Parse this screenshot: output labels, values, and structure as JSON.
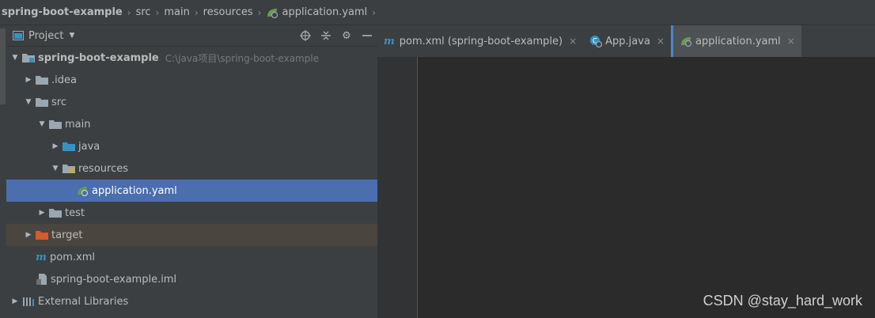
{
  "breadcrumb": [
    "spring-boot-example",
    "src",
    "main",
    "resources",
    "application.yaml"
  ],
  "project_panel": {
    "title": "Project"
  },
  "tree": [
    {
      "label": "spring-boot-example",
      "path": "C:\\java项目\\spring-boot-example",
      "depth": 0,
      "expanded": true,
      "kind": "module"
    },
    {
      "label": ".idea",
      "depth": 1,
      "expanded": false,
      "kind": "folder"
    },
    {
      "label": "src",
      "depth": 1,
      "expanded": true,
      "kind": "folder"
    },
    {
      "label": "main",
      "depth": 2,
      "expanded": true,
      "kind": "folder"
    },
    {
      "label": "java",
      "depth": 3,
      "expanded": false,
      "kind": "source-folder"
    },
    {
      "label": "resources",
      "depth": 3,
      "expanded": true,
      "kind": "resource-folder"
    },
    {
      "label": "application.yaml",
      "depth": 5,
      "kind": "spring-yaml",
      "selected": true
    },
    {
      "label": "test",
      "depth": 2,
      "expanded": false,
      "kind": "folder"
    },
    {
      "label": "target",
      "depth": 1,
      "expanded": false,
      "kind": "excluded-folder"
    },
    {
      "label": "pom.xml",
      "depth": 1,
      "kind": "maven"
    },
    {
      "label": "spring-boot-example.iml",
      "depth": 1,
      "kind": "iml"
    },
    {
      "label": "External Libraries",
      "depth": 0,
      "expanded": false,
      "kind": "libraries"
    }
  ],
  "tabs": [
    {
      "label": "pom.xml (spring-boot-example)",
      "icon": "maven-icon"
    },
    {
      "label": "App.java",
      "icon": "java-class-icon"
    },
    {
      "label": "application.yaml",
      "icon": "spring-yaml-icon",
      "active": true
    }
  ],
  "watermark": "CSDN @stay_hard_work",
  "colors": {
    "selection": "#4b6eaf",
    "panel_bg": "#3c3f41",
    "editor_bg": "#2b2b2b",
    "excluded_bg": "#4a463f",
    "active_tab_accent": "#4a88c7"
  }
}
